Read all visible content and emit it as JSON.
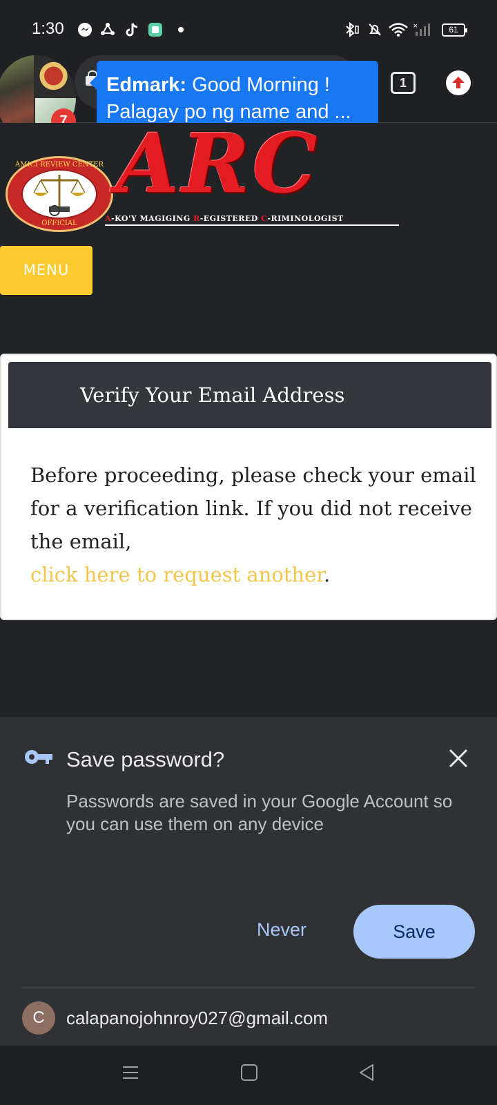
{
  "status_bar": {
    "time": "1:30",
    "battery": "61",
    "icons": [
      "messenger-icon",
      "share-icon",
      "tiktok-icon",
      "app-icon",
      "bluetooth-icon",
      "mute-icon",
      "wifi-icon",
      "signal-icon"
    ]
  },
  "toolbar": {
    "tab_count": "1"
  },
  "chat_head": {
    "badge_count": "7",
    "sender": "Edmark:",
    "line1_rest": "Good Morning !",
    "line2": "Palagay po ng name and ..."
  },
  "site": {
    "logo_title": "ARC",
    "seal_top": "AMICI REVIEW CENTER",
    "seal_bottom": "OFFICIAL",
    "tagline_a": "A",
    "tagline_1": "-KO'Y MAGIGING ",
    "tagline_r": "R",
    "tagline_2": "-EGISTERED ",
    "tagline_c": "C",
    "tagline_3": "-RIMINOLOGIST",
    "menu_label": "MENU",
    "card_title": "Verify Your Email Address",
    "card_text": "Before proceeding, please check your email for a verification link. If you did not receive the email,",
    "card_link": "click here to request another",
    "card_period": ".",
    "brand_yellow": "#fdcb2f",
    "brand_red": "#e31b23"
  },
  "save_password": {
    "title": "Save password?",
    "description": "Passwords are saved in your Google Account so you can use them on any device",
    "never_label": "Never",
    "save_label": "Save",
    "account_initial": "C",
    "account_email": "calapanojohnroy027@gmail.com",
    "accent": "#a8c7fa"
  }
}
